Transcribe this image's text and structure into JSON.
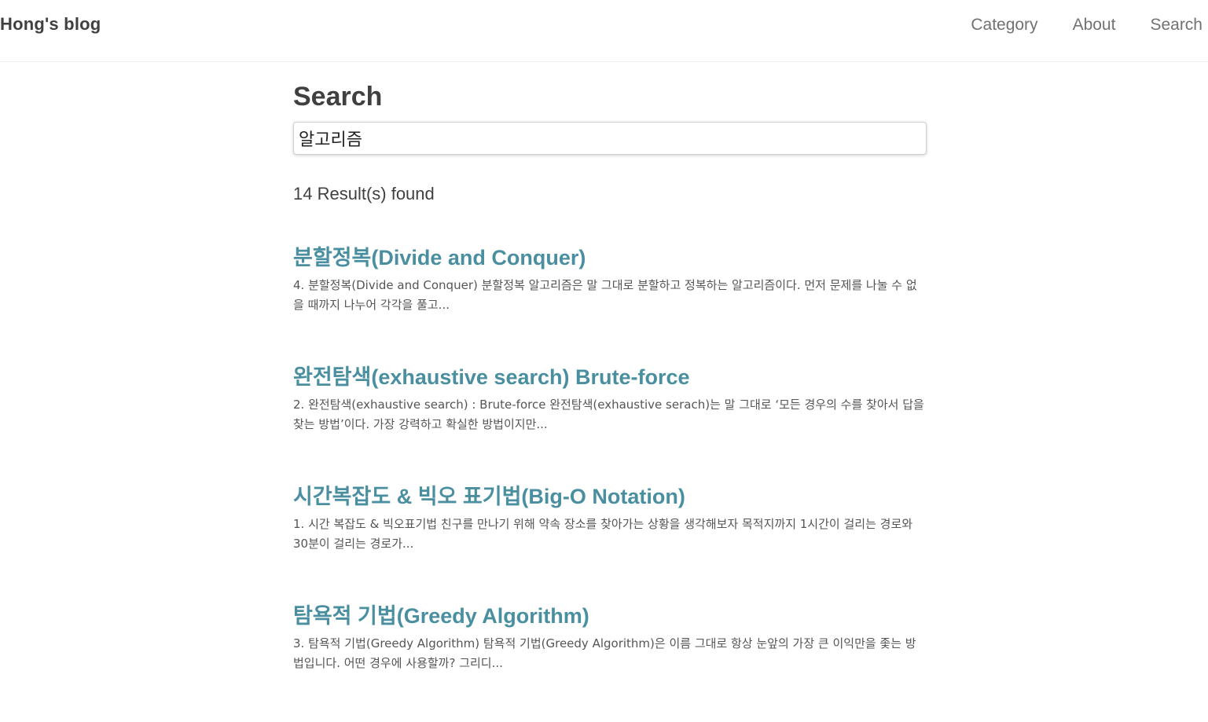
{
  "header": {
    "brand": "Hong's blog",
    "nav": [
      {
        "label": "Category"
      },
      {
        "label": "About"
      },
      {
        "label": "Search"
      }
    ]
  },
  "main": {
    "title": "Search",
    "search": {
      "value": "알고리즘"
    },
    "result_count": "14 Result(s) found",
    "results": [
      {
        "title": "분할정복(Divide and Conquer)",
        "excerpt": "4. 분할정복(Divide and Conquer) 분할정복 알고리즘은 말 그대로 분할하고 정복하는 알고리즘이다. 먼저 문제를 나눌 수 없을 때까지 나누어 각각을 풀고..."
      },
      {
        "title": "완전탐색(exhaustive search) Brute-force",
        "excerpt": "2. 완전탐색(exhaustive search) : Brute-force 완전탐색(exhaustive serach)는 말 그대로 ‘모든 경우의 수를 찾아서 답을 찾는 방법’이다. 가장 강력하고 확실한 방법이지만..."
      },
      {
        "title": "시간복잡도 & 빅오 표기법(Big-O Notation)",
        "excerpt": "1. 시간 복잡도 & 빅오표기법 친구를 만나기 위해 약속 장소를 찾아가는 상황을 생각해보자 목적지까지 1시간이 걸리는 경로와 30분이 걸리는 경로가..."
      },
      {
        "title": "탐욕적 기법(Greedy Algorithm)",
        "excerpt": "3. 탐욕적 기법(Greedy Algorithm) 탐욕적 기법(Greedy Algorithm)은 이름 그대로 항상 눈앞의 가장 큰 이익만을 좇는 방법입니다. 어떤 경우에 사용할까? 그리디..."
      }
    ]
  },
  "colors": {
    "link": "#4a8fa0",
    "heading": "#404040",
    "nav": "#727272"
  }
}
